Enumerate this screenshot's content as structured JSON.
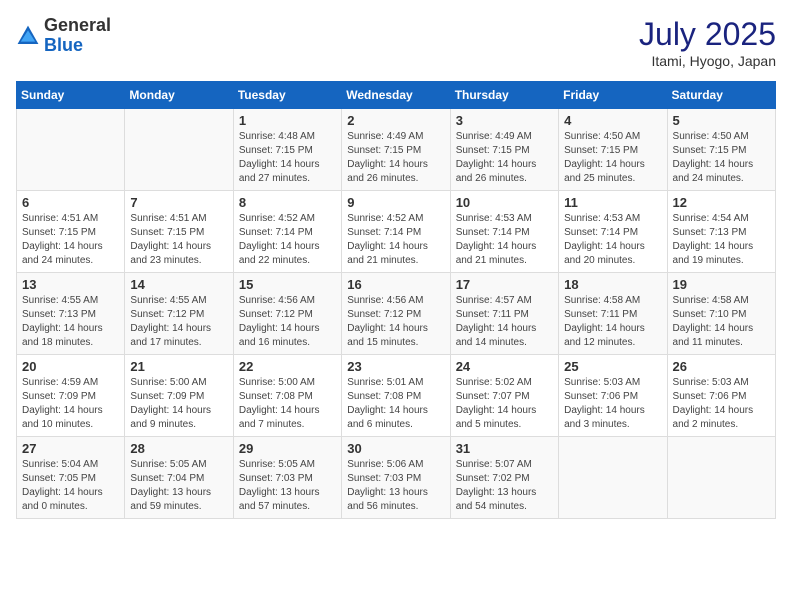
{
  "header": {
    "logo_general": "General",
    "logo_blue": "Blue",
    "month_year": "July 2025",
    "location": "Itami, Hyogo, Japan"
  },
  "calendar": {
    "days_of_week": [
      "Sunday",
      "Monday",
      "Tuesday",
      "Wednesday",
      "Thursday",
      "Friday",
      "Saturday"
    ],
    "weeks": [
      [
        {
          "day": "",
          "detail": ""
        },
        {
          "day": "",
          "detail": ""
        },
        {
          "day": "1",
          "detail": "Sunrise: 4:48 AM\nSunset: 7:15 PM\nDaylight: 14 hours\nand 27 minutes."
        },
        {
          "day": "2",
          "detail": "Sunrise: 4:49 AM\nSunset: 7:15 PM\nDaylight: 14 hours\nand 26 minutes."
        },
        {
          "day": "3",
          "detail": "Sunrise: 4:49 AM\nSunset: 7:15 PM\nDaylight: 14 hours\nand 26 minutes."
        },
        {
          "day": "4",
          "detail": "Sunrise: 4:50 AM\nSunset: 7:15 PM\nDaylight: 14 hours\nand 25 minutes."
        },
        {
          "day": "5",
          "detail": "Sunrise: 4:50 AM\nSunset: 7:15 PM\nDaylight: 14 hours\nand 24 minutes."
        }
      ],
      [
        {
          "day": "6",
          "detail": "Sunrise: 4:51 AM\nSunset: 7:15 PM\nDaylight: 14 hours\nand 24 minutes."
        },
        {
          "day": "7",
          "detail": "Sunrise: 4:51 AM\nSunset: 7:15 PM\nDaylight: 14 hours\nand 23 minutes."
        },
        {
          "day": "8",
          "detail": "Sunrise: 4:52 AM\nSunset: 7:14 PM\nDaylight: 14 hours\nand 22 minutes."
        },
        {
          "day": "9",
          "detail": "Sunrise: 4:52 AM\nSunset: 7:14 PM\nDaylight: 14 hours\nand 21 minutes."
        },
        {
          "day": "10",
          "detail": "Sunrise: 4:53 AM\nSunset: 7:14 PM\nDaylight: 14 hours\nand 21 minutes."
        },
        {
          "day": "11",
          "detail": "Sunrise: 4:53 AM\nSunset: 7:14 PM\nDaylight: 14 hours\nand 20 minutes."
        },
        {
          "day": "12",
          "detail": "Sunrise: 4:54 AM\nSunset: 7:13 PM\nDaylight: 14 hours\nand 19 minutes."
        }
      ],
      [
        {
          "day": "13",
          "detail": "Sunrise: 4:55 AM\nSunset: 7:13 PM\nDaylight: 14 hours\nand 18 minutes."
        },
        {
          "day": "14",
          "detail": "Sunrise: 4:55 AM\nSunset: 7:12 PM\nDaylight: 14 hours\nand 17 minutes."
        },
        {
          "day": "15",
          "detail": "Sunrise: 4:56 AM\nSunset: 7:12 PM\nDaylight: 14 hours\nand 16 minutes."
        },
        {
          "day": "16",
          "detail": "Sunrise: 4:56 AM\nSunset: 7:12 PM\nDaylight: 14 hours\nand 15 minutes."
        },
        {
          "day": "17",
          "detail": "Sunrise: 4:57 AM\nSunset: 7:11 PM\nDaylight: 14 hours\nand 14 minutes."
        },
        {
          "day": "18",
          "detail": "Sunrise: 4:58 AM\nSunset: 7:11 PM\nDaylight: 14 hours\nand 12 minutes."
        },
        {
          "day": "19",
          "detail": "Sunrise: 4:58 AM\nSunset: 7:10 PM\nDaylight: 14 hours\nand 11 minutes."
        }
      ],
      [
        {
          "day": "20",
          "detail": "Sunrise: 4:59 AM\nSunset: 7:09 PM\nDaylight: 14 hours\nand 10 minutes."
        },
        {
          "day": "21",
          "detail": "Sunrise: 5:00 AM\nSunset: 7:09 PM\nDaylight: 14 hours\nand 9 minutes."
        },
        {
          "day": "22",
          "detail": "Sunrise: 5:00 AM\nSunset: 7:08 PM\nDaylight: 14 hours\nand 7 minutes."
        },
        {
          "day": "23",
          "detail": "Sunrise: 5:01 AM\nSunset: 7:08 PM\nDaylight: 14 hours\nand 6 minutes."
        },
        {
          "day": "24",
          "detail": "Sunrise: 5:02 AM\nSunset: 7:07 PM\nDaylight: 14 hours\nand 5 minutes."
        },
        {
          "day": "25",
          "detail": "Sunrise: 5:03 AM\nSunset: 7:06 PM\nDaylight: 14 hours\nand 3 minutes."
        },
        {
          "day": "26",
          "detail": "Sunrise: 5:03 AM\nSunset: 7:06 PM\nDaylight: 14 hours\nand 2 minutes."
        }
      ],
      [
        {
          "day": "27",
          "detail": "Sunrise: 5:04 AM\nSunset: 7:05 PM\nDaylight: 14 hours\nand 0 minutes."
        },
        {
          "day": "28",
          "detail": "Sunrise: 5:05 AM\nSunset: 7:04 PM\nDaylight: 13 hours\nand 59 minutes."
        },
        {
          "day": "29",
          "detail": "Sunrise: 5:05 AM\nSunset: 7:03 PM\nDaylight: 13 hours\nand 57 minutes."
        },
        {
          "day": "30",
          "detail": "Sunrise: 5:06 AM\nSunset: 7:03 PM\nDaylight: 13 hours\nand 56 minutes."
        },
        {
          "day": "31",
          "detail": "Sunrise: 5:07 AM\nSunset: 7:02 PM\nDaylight: 13 hours\nand 54 minutes."
        },
        {
          "day": "",
          "detail": ""
        },
        {
          "day": "",
          "detail": ""
        }
      ]
    ]
  }
}
